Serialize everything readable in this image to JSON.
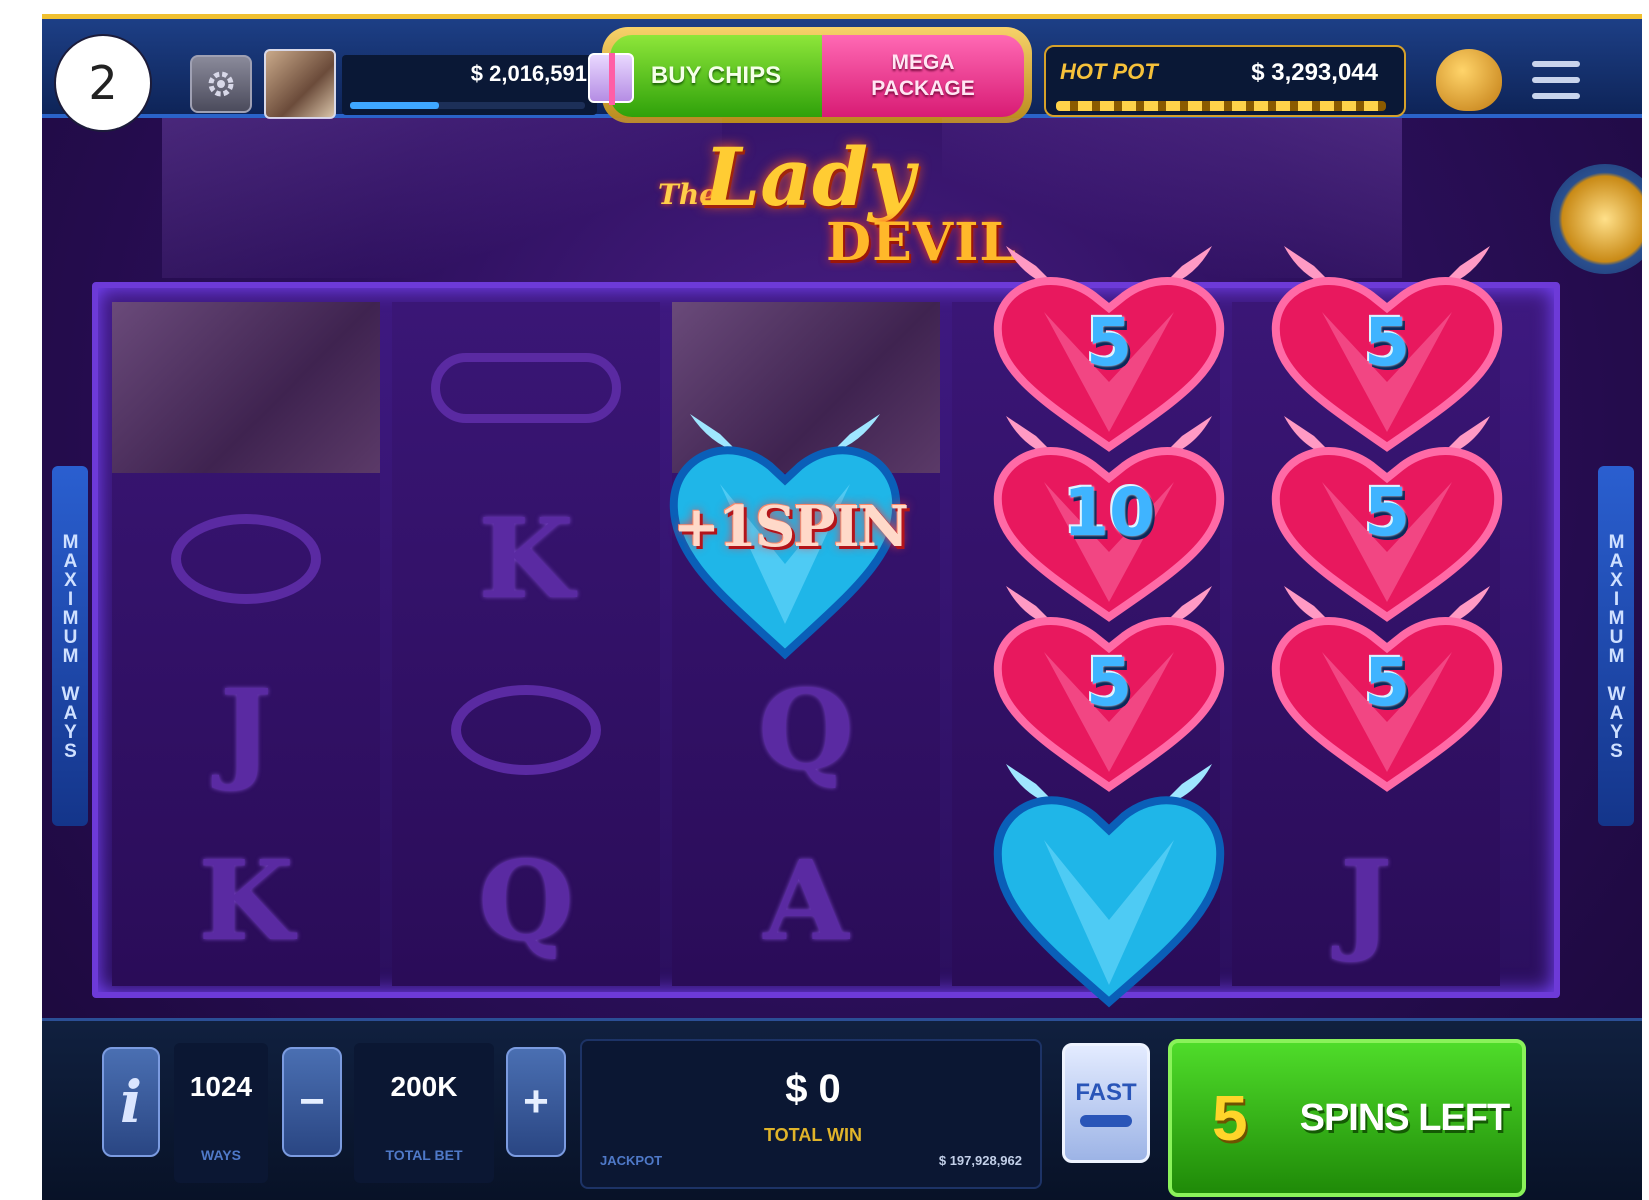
{
  "step_badge": "2",
  "top_bar": {
    "balance": "$ 2,016,591",
    "buy_chips_label": "BUY CHIPS",
    "mega_package_line1": "MEGA",
    "mega_package_line2": "PACKAGE",
    "jackpot_label": "HOT POT",
    "jackpot_value": "$ 3,293,044",
    "xp_progress": 0.38
  },
  "game": {
    "logo_the": "The",
    "logo_lady": "Lady",
    "logo_devil": "DEVIL",
    "side_label": "MAXIMUM WAYS",
    "reels": [
      [
        "photo",
        "ring",
        "J",
        "K"
      ],
      [
        "glasses",
        "K",
        "ring",
        "Q"
      ],
      [
        "photo",
        "",
        "Q",
        "A"
      ],
      [
        "",
        "",
        "",
        ""
      ],
      [
        "",
        "",
        "",
        "J"
      ]
    ],
    "hearts": [
      {
        "label": "5"
      },
      {
        "label": "5"
      },
      {
        "label": "10"
      },
      {
        "label": "5"
      },
      {
        "label": "5"
      },
      {
        "label": "5"
      }
    ],
    "bonus_heart_label": "+1SPIN"
  },
  "bottom_bar": {
    "info_label": "i",
    "ways_value": "1024",
    "ways_label": "WAYS",
    "minus_label": "−",
    "bet_value": "200K",
    "bet_label": "TOTAL BET",
    "plus_label": "+",
    "win_value": "$ 0",
    "win_label": "TOTAL WIN",
    "grand_label": "JACKPOT",
    "grand_value": "$ 197,928,962",
    "fast_label": "FAST",
    "spins_count": "5",
    "spins_label": "SPINS LEFT"
  },
  "colors": {
    "heart_pink": "#e8185e",
    "heart_blue": "#1fb6e8",
    "accent_gold": "#f0c030"
  }
}
